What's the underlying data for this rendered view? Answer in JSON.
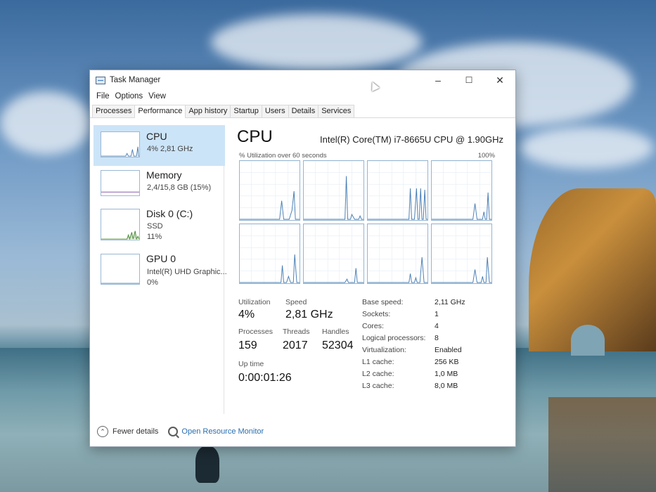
{
  "window": {
    "title": "Task Manager",
    "controls": {
      "minimize": "–",
      "maximize": "☐",
      "close": "✕"
    }
  },
  "menu": [
    "File",
    "Options",
    "View"
  ],
  "tabs": [
    "Processes",
    "Performance",
    "App history",
    "Startup",
    "Users",
    "Details",
    "Services"
  ],
  "active_tab": "Performance",
  "sidebar": {
    "items": [
      {
        "title": "CPU",
        "sub1": "4% 2,81 GHz",
        "sub2": "",
        "selected": true
      },
      {
        "title": "Memory",
        "sub1": "2,4/15,8 GB (15%)",
        "sub2": ""
      },
      {
        "title": "Disk 0 (C:)",
        "sub1": "SSD",
        "sub2": "11%"
      },
      {
        "title": "GPU 0",
        "sub1": "Intel(R) UHD Graphic...",
        "sub2": "0%"
      }
    ]
  },
  "cpu": {
    "heading": "CPU",
    "model": "Intel(R) Core(TM) i7-8665U CPU @ 1.90GHz",
    "graph_caption": "% Utilization over 60 seconds",
    "graph_max": "100%",
    "stats": {
      "utilization_label": "Utilization",
      "utilization": "4%",
      "speed_label": "Speed",
      "speed": "2,81 GHz",
      "processes_label": "Processes",
      "processes": "159",
      "threads_label": "Threads",
      "threads": "2017",
      "handles_label": "Handles",
      "handles": "52304",
      "uptime_label": "Up time",
      "uptime": "0:00:01:26"
    },
    "specs": [
      {
        "k": "Base speed:",
        "v": "2,11 GHz"
      },
      {
        "k": "Sockets:",
        "v": "1"
      },
      {
        "k": "Cores:",
        "v": "4"
      },
      {
        "k": "Logical processors:",
        "v": "8"
      },
      {
        "k": "Virtualization:",
        "v": "Enabled"
      },
      {
        "k": "L1 cache:",
        "v": "256 KB"
      },
      {
        "k": "L2 cache:",
        "v": "1,0 MB"
      },
      {
        "k": "L3 cache:",
        "v": "8,0 MB"
      }
    ]
  },
  "footer": {
    "fewer_details": "Fewer details",
    "open_monitor": "Open Resource Monitor"
  },
  "colors": {
    "graph_line": "#4a7fb5",
    "graph_border": "#94b4d2",
    "selected_bg": "#cce4f7",
    "disk_line": "#4a8a3a",
    "link": "#2a6fb0"
  },
  "icons": {
    "app": "task-manager-icon",
    "chevron": "chevron-up-icon",
    "monitor": "resource-monitor-icon",
    "cursor": "mouse-cursor-icon"
  }
}
